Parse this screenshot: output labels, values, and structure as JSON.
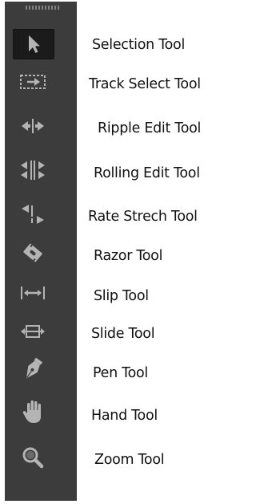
{
  "tools": [
    {
      "label": "Selection Tool",
      "icon": "arrow-pointer-icon",
      "selected": true
    },
    {
      "label": "Track Select Tool",
      "icon": "track-select-icon",
      "selected": false
    },
    {
      "label": "Ripple Edit Tool",
      "icon": "ripple-edit-icon",
      "selected": false
    },
    {
      "label": "Rolling Edit Tool",
      "icon": "rolling-edit-icon",
      "selected": false
    },
    {
      "label": "Rate Strech Tool",
      "icon": "rate-stretch-icon",
      "selected": false
    },
    {
      "label": "Razor Tool",
      "icon": "razor-icon",
      "selected": false
    },
    {
      "label": "Slip Tool",
      "icon": "slip-icon",
      "selected": false
    },
    {
      "label": "Slide Tool",
      "icon": "slide-icon",
      "selected": false
    },
    {
      "label": "Pen Tool",
      "icon": "pen-icon",
      "selected": false
    },
    {
      "label": "Hand Tool",
      "icon": "hand-icon",
      "selected": false
    },
    {
      "label": "Zoom Tool",
      "icon": "zoom-icon",
      "selected": false
    }
  ],
  "colors": {
    "panel": "#3c3c3c",
    "icon": "#b4b4b4",
    "selected_bg": "#1b1b1b",
    "label_text": "#111111"
  }
}
